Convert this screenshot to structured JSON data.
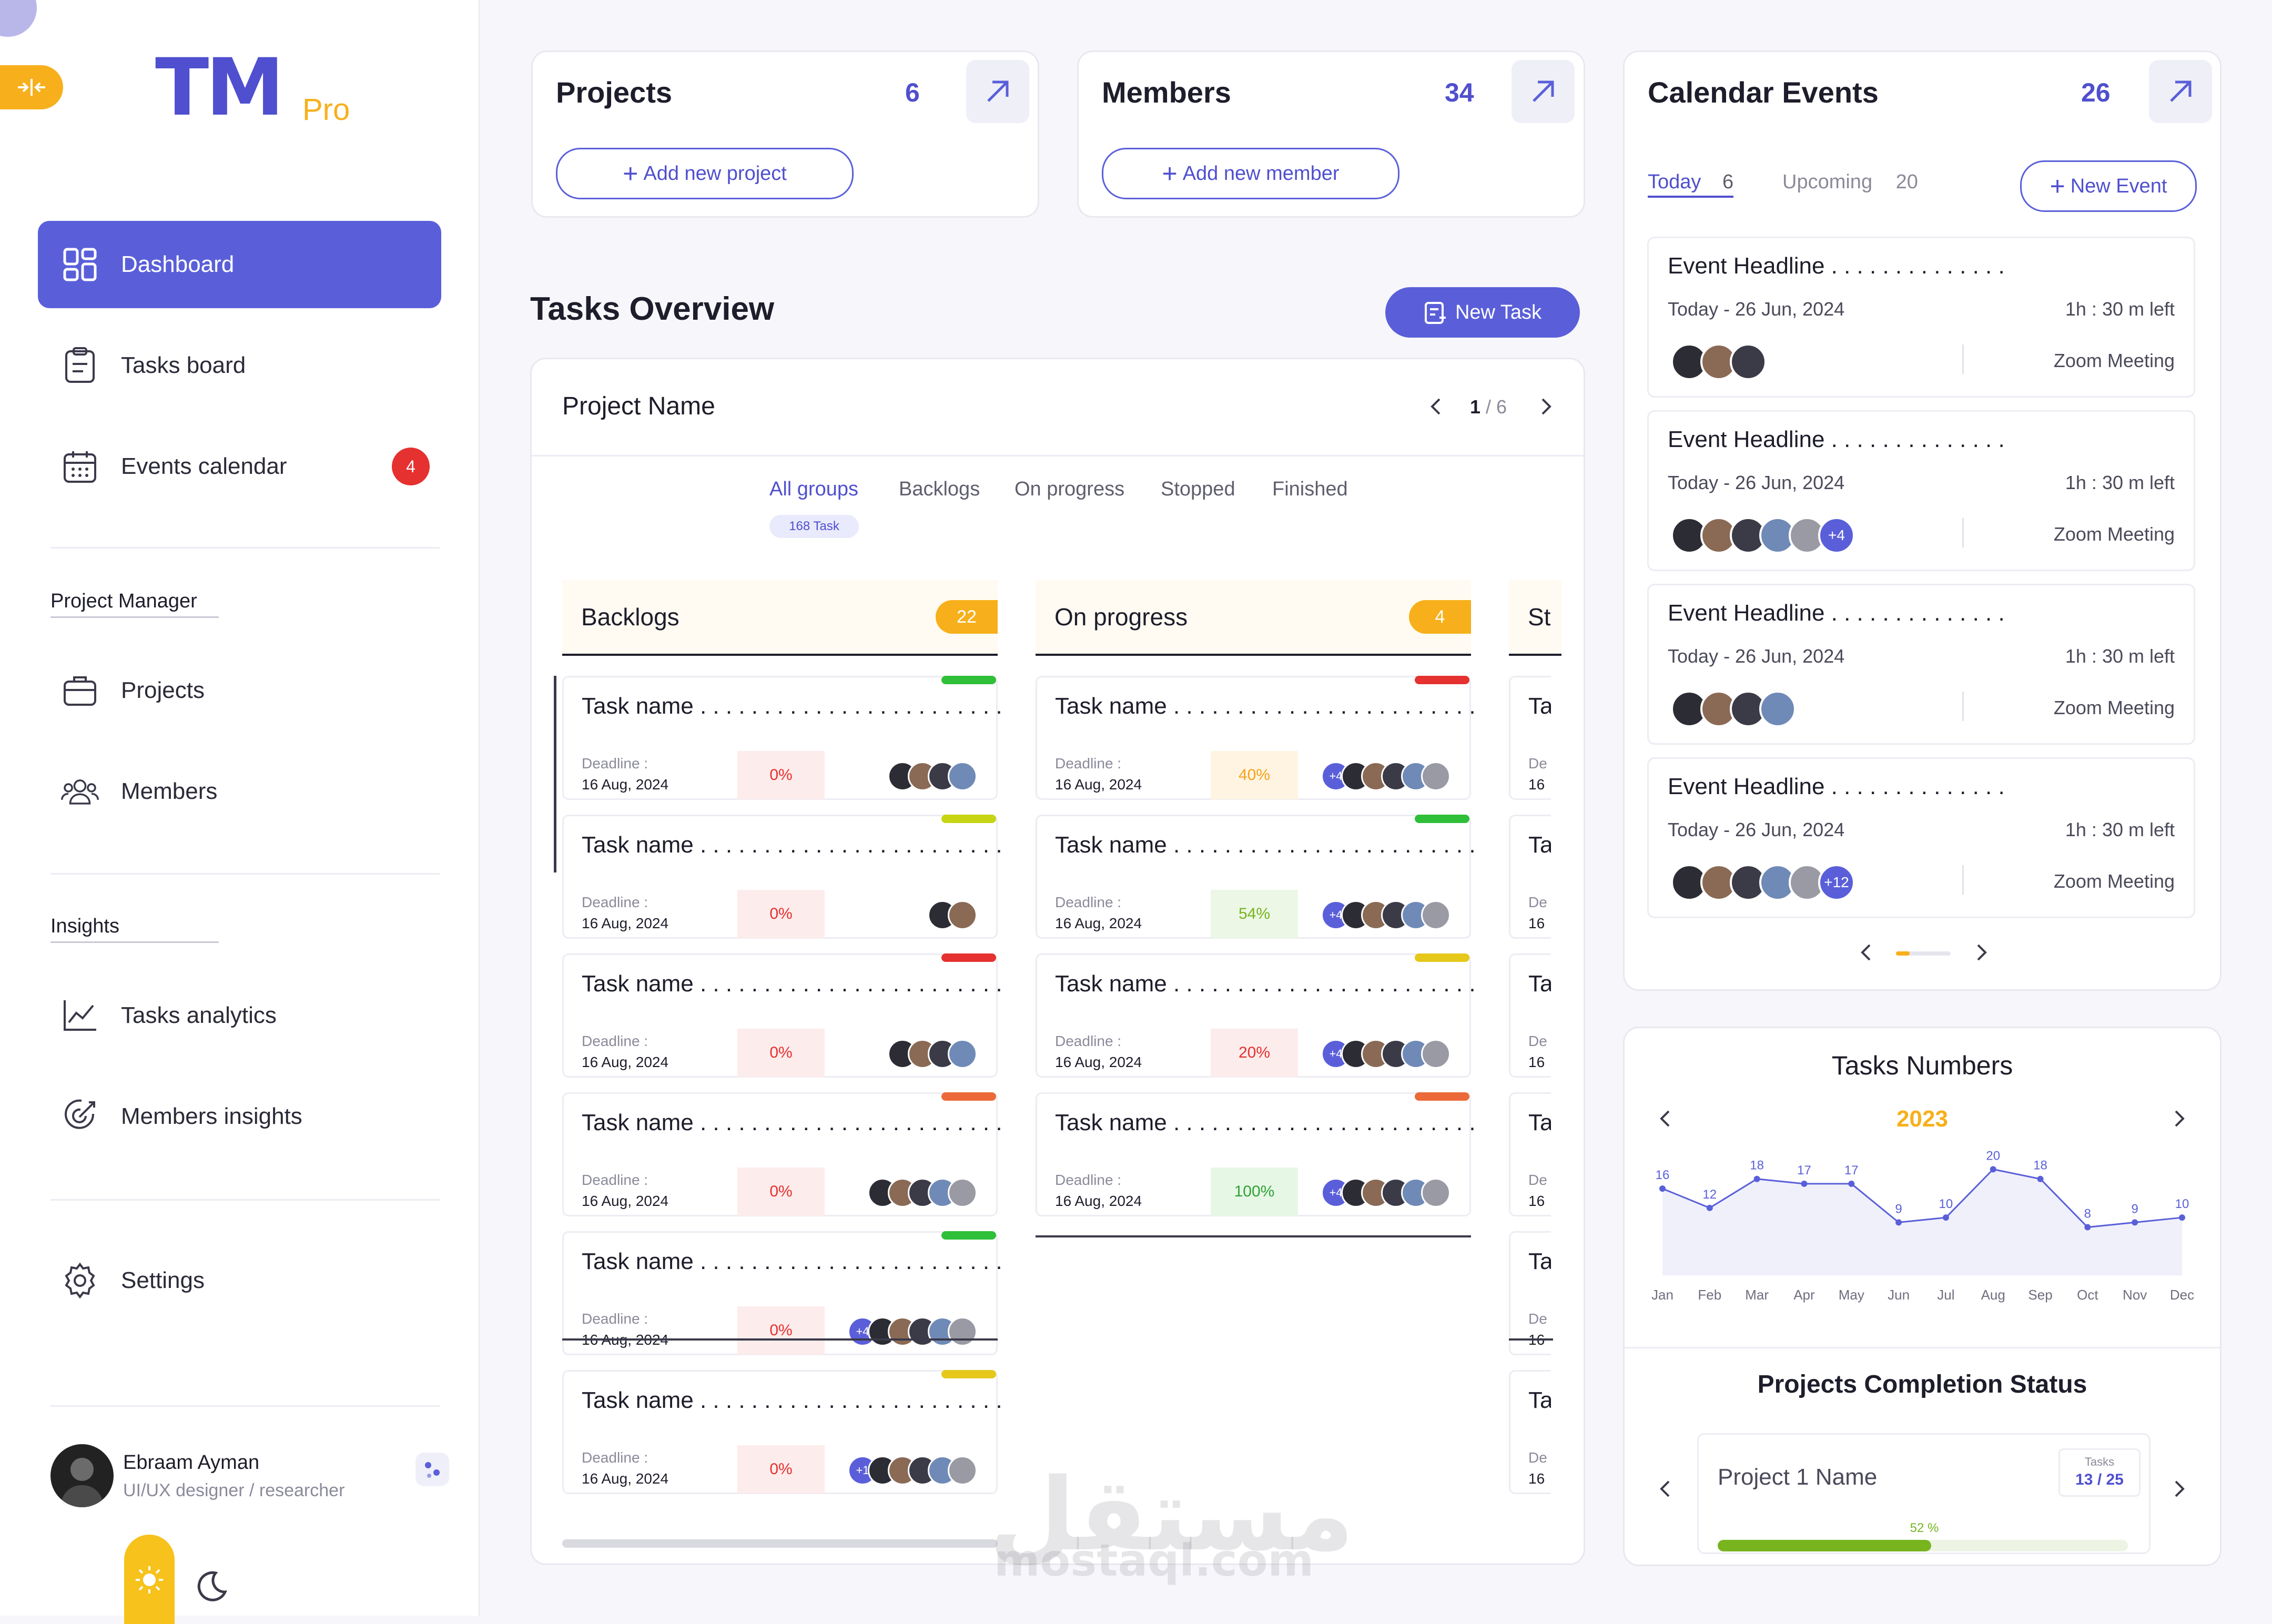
{
  "sidebar": {
    "logo_main": "TM",
    "logo_pro": "Pro",
    "nav": [
      {
        "label": "Dashboard"
      },
      {
        "label": "Tasks board"
      },
      {
        "label": "Events calendar",
        "badge": "4"
      }
    ],
    "section_pm": "Project Manager",
    "pm_items": [
      {
        "label": "Projects"
      },
      {
        "label": "Members"
      }
    ],
    "section_insights": "Insights",
    "insight_items": [
      {
        "label": "Tasks analytics"
      },
      {
        "label": "Members insights"
      }
    ],
    "settings_label": "Settings",
    "profile": {
      "name": "Ebraam Ayman",
      "role": "UI/UX designer / researcher"
    }
  },
  "stats": {
    "projects": {
      "title": "Projects",
      "count": "6",
      "button": "Add new project"
    },
    "members": {
      "title": "Members",
      "count": "34",
      "button": "Add new member"
    }
  },
  "tasks_overview": {
    "title": "Tasks Overview",
    "new_task": "New Task",
    "project_name": "Project Name",
    "page_current": "1",
    "page_total": "/ 6",
    "tabs": [
      "All groups",
      "Backlogs",
      "On progress",
      "Stopped",
      "Finished"
    ],
    "all_count": "168 Task",
    "columns": [
      {
        "title": "Backlogs",
        "count": "22"
      },
      {
        "title": "On progress",
        "count": "4"
      },
      {
        "title": "St"
      }
    ],
    "task_name": "Task name . . . . . . . . . . . . . . . . . . . . . . . .",
    "deadline_label": "Deadline :",
    "deadline_value": "16 Aug, 2024",
    "backlog_tasks": [
      {
        "progress": "0%",
        "extra": ""
      },
      {
        "progress": "0%",
        "extra": ""
      },
      {
        "progress": "0%",
        "extra": ""
      },
      {
        "progress": "0%",
        "extra": ""
      },
      {
        "progress": "0%",
        "extra": "+4"
      },
      {
        "progress": "0%",
        "extra": "+1"
      }
    ],
    "progress_tasks": [
      {
        "progress": "40%",
        "extra": "+4"
      },
      {
        "progress": "54%",
        "extra": "+4"
      },
      {
        "progress": "20%",
        "extra": "+4"
      },
      {
        "progress": "100%",
        "extra": "+4"
      }
    ],
    "clipped_task": {
      "name": "Ta",
      "dl": "De",
      "date": "16"
    }
  },
  "calendar": {
    "title": "Calendar Events",
    "count": "26",
    "today_label": "Today",
    "today_count": "6",
    "upcoming_label": "Upcoming",
    "upcoming_count": "20",
    "new_event": "New Event",
    "events": [
      {
        "headline": "Event Headline . . . . . . . . . . . . . .",
        "date": "Today - 26 Jun, 2024",
        "left": "1h : 30 m left",
        "meeting": "Zoom Meeting",
        "extra": ""
      },
      {
        "headline": "Event Headline . . . . . . . . . . . . . .",
        "date": "Today - 26 Jun, 2024",
        "left": "1h : 30 m left",
        "meeting": "Zoom Meeting",
        "extra": "+4"
      },
      {
        "headline": "Event Headline . . . . . . . . . . . . . .",
        "date": "Today - 26 Jun, 2024",
        "left": "1h : 30 m left",
        "meeting": "Zoom Meeting",
        "extra": ""
      },
      {
        "headline": "Event Headline . . . . . . . . . . . . . .",
        "date": "Today - 26 Jun, 2024",
        "left": "1h : 30 m left",
        "meeting": "Zoom Meeting",
        "extra": "+12"
      }
    ]
  },
  "tasks_numbers": {
    "title": "Tasks Numbers",
    "year": "2023"
  },
  "chart_data": {
    "type": "line",
    "title": "Tasks Numbers",
    "subtitle": "2023",
    "categories": [
      "Jan",
      "Feb",
      "Mar",
      "Apr",
      "May",
      "Jun",
      "Jul",
      "Aug",
      "Sep",
      "Oct",
      "Nov",
      "Dec"
    ],
    "values": [
      16,
      12,
      18,
      17,
      17,
      9,
      10,
      20,
      18,
      8,
      9,
      10
    ],
    "ylim": [
      0,
      22
    ],
    "grid": false,
    "color": "#5a5fd9"
  },
  "completion": {
    "title": "Projects Completion Status",
    "project": "Project 1 Name",
    "tasks_label": "Tasks",
    "tasks_value": "13 / 25",
    "percent": "52 %",
    "fraction": 0.52
  },
  "watermark": {
    "arabic": "مستقل",
    "latin": "mostaql.com"
  }
}
